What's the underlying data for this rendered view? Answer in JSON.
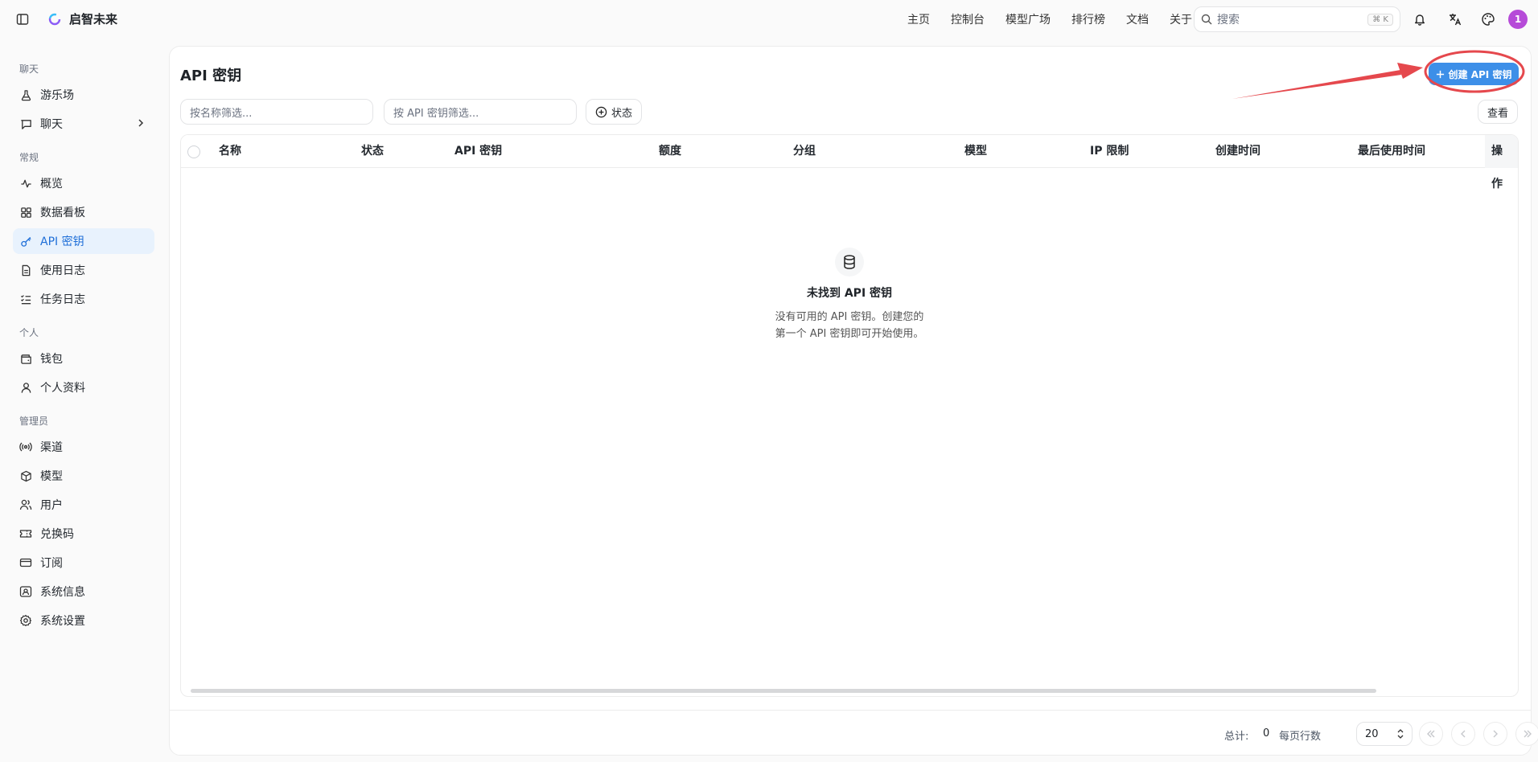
{
  "brand": {
    "name": "启智未来"
  },
  "topnav": [
    "主页",
    "控制台",
    "模型广场",
    "排行榜",
    "文档",
    "关于"
  ],
  "search": {
    "placeholder": "搜索",
    "shortcut": "⌘ K"
  },
  "user": {
    "avatar_text": "1",
    "avatar_color": "#b64bd8"
  },
  "sidebar": {
    "sections": [
      {
        "title": "聊天",
        "items": [
          {
            "label": "游乐场",
            "icon": "flask-icon"
          },
          {
            "label": "聊天",
            "icon": "message-icon",
            "has_children": true
          }
        ]
      },
      {
        "title": "常规",
        "items": [
          {
            "label": "概览",
            "icon": "activity-icon"
          },
          {
            "label": "数据看板",
            "icon": "dashboard-icon"
          },
          {
            "label": "API 密钥",
            "icon": "key-icon",
            "active": true
          },
          {
            "label": "使用日志",
            "icon": "file-text-icon"
          },
          {
            "label": "任务日志",
            "icon": "list-checks-icon"
          }
        ]
      },
      {
        "title": "个人",
        "items": [
          {
            "label": "钱包",
            "icon": "wallet-icon"
          },
          {
            "label": "个人资料",
            "icon": "user-icon"
          }
        ]
      },
      {
        "title": "管理员",
        "items": [
          {
            "label": "渠道",
            "icon": "radio-icon"
          },
          {
            "label": "模型",
            "icon": "box-icon"
          },
          {
            "label": "用户",
            "icon": "users-icon"
          },
          {
            "label": "兑换码",
            "icon": "ticket-icon"
          },
          {
            "label": "订阅",
            "icon": "card-icon"
          },
          {
            "label": "系统信息",
            "icon": "info-icon"
          },
          {
            "label": "系统设置",
            "icon": "gear-icon"
          }
        ]
      }
    ]
  },
  "page": {
    "title": "API 密钥",
    "create_button": "创建 API 密钥",
    "filter_name_placeholder": "按名称筛选...",
    "filter_key_placeholder": "按 API 密钥筛选...",
    "status_button": "状态",
    "view_button": "查看"
  },
  "table": {
    "columns": [
      "名称",
      "状态",
      "API 密钥",
      "额度",
      "分组",
      "模型",
      "IP 限制",
      "创建时间",
      "最后使用时间",
      "操作"
    ],
    "rows": [],
    "empty_title": "未找到 API 密钥",
    "empty_desc_line1": "没有可用的 API 密钥。创建您的",
    "empty_desc_line2": "第一个 API 密钥即可开始使用。"
  },
  "footer": {
    "total_label": "总计:",
    "total_value": "0",
    "rows_per_page_label": "每页行数",
    "rows_per_page": "20"
  },
  "colors": {
    "accent": "#3d8fe8",
    "active_bg": "#e8f2fd",
    "annotation": "#e5484d"
  }
}
